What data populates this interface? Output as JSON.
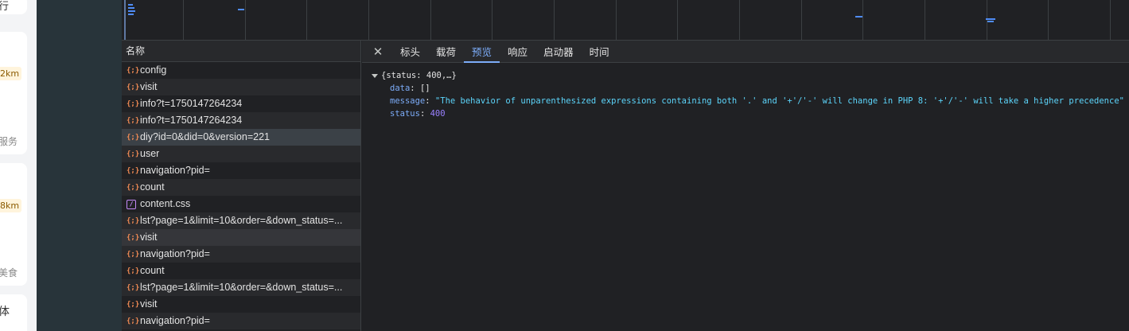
{
  "page_fragment": {
    "texts": [
      "行",
      "2km",
      "服务",
      "8km",
      "美食",
      "体"
    ]
  },
  "devtools": {
    "request_list": {
      "header": "名称",
      "rows": [
        {
          "icon": "json-icon",
          "label": "config"
        },
        {
          "icon": "json-icon",
          "label": "visit"
        },
        {
          "icon": "json-icon",
          "label": "info?t=1750147264234"
        },
        {
          "icon": "json-icon",
          "label": "info?t=1750147264234"
        },
        {
          "icon": "json-icon",
          "label": "diy?id=0&did=0&version=221"
        },
        {
          "icon": "json-icon",
          "label": "user"
        },
        {
          "icon": "json-icon",
          "label": "navigation?pid="
        },
        {
          "icon": "json-icon",
          "label": "count"
        },
        {
          "icon": "css-icon",
          "label": "content.css"
        },
        {
          "icon": "json-icon",
          "label": "lst?page=1&limit=10&order=&down_status=..."
        },
        {
          "icon": "json-icon",
          "label": "visit"
        },
        {
          "icon": "json-icon",
          "label": "navigation?pid="
        },
        {
          "icon": "json-icon",
          "label": "count"
        },
        {
          "icon": "json-icon",
          "label": "lst?page=1&limit=10&order=&down_status=..."
        },
        {
          "icon": "json-icon",
          "label": "visit"
        },
        {
          "icon": "json-icon",
          "label": "navigation?pid="
        }
      ]
    },
    "tabs": {
      "close_glyph": "✕",
      "items": [
        "标头",
        "载荷",
        "预览",
        "响应",
        "启动器",
        "时间"
      ],
      "active": "预览"
    },
    "preview": {
      "root_summary": "{status: 400,…}",
      "fields": [
        {
          "key": "data",
          "value": "[]",
          "type": "plain"
        },
        {
          "key": "message",
          "value": "\"The behavior of unparenthesized expressions containing both '.' and '+'/'-' will change in PHP 8: '+'/'-' will take a higher precedence\"",
          "type": "str"
        },
        {
          "key": "status",
          "value": "400",
          "type": "num"
        }
      ]
    }
  },
  "colors": {
    "background": "#202124",
    "accent": "#7cacf8",
    "selected_row": "#3b4147"
  }
}
